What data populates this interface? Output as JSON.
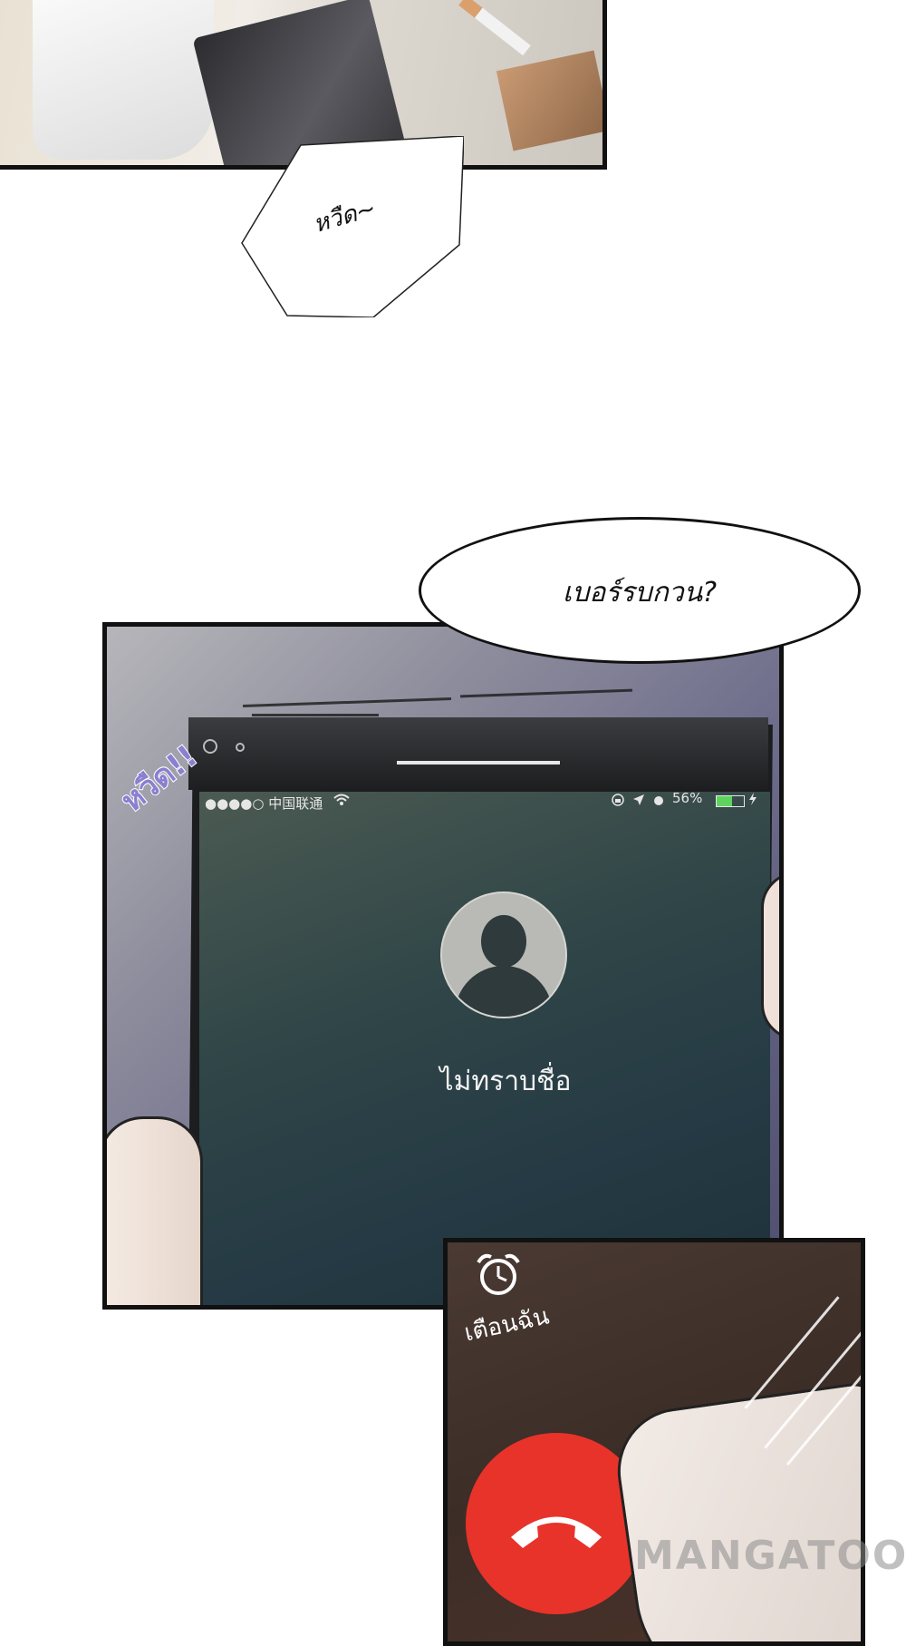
{
  "bubbles": {
    "swish_small": "หวืด~",
    "question": "เบอร์รบกวน?"
  },
  "sfx": {
    "swish_big": "หวืด!!"
  },
  "phone": {
    "carrier": "●●●●○ 中国联通",
    "battery_percent": "56%",
    "battery_level": 0.56,
    "caller": "ไม่ทราบชื่อ"
  },
  "decline_screen": {
    "remind_label": "เตือนฉัน"
  },
  "watermark": "MANGATOON",
  "colors": {
    "decline_red": "#e8332a",
    "sfx_purple": "#8a7fd0",
    "battery_green": "#5fd35f"
  },
  "icons": [
    "wifi-icon",
    "lock-rotation-icon",
    "location-arrow-icon",
    "alarm-icon",
    "charging-bolt-icon",
    "contact-silhouette-icon",
    "alarm-clock-icon",
    "phone-hangup-icon"
  ]
}
